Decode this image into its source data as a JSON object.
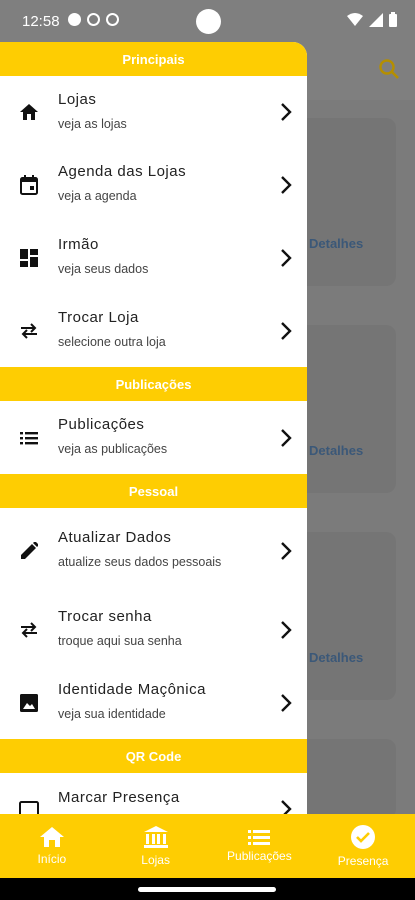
{
  "status_bar": {
    "time": "12:58"
  },
  "drawer": {
    "sections": [
      {
        "title": "Principais",
        "items": [
          {
            "title": "Lojas",
            "subtitle": "veja as lojas",
            "icon": "home-icon"
          },
          {
            "title": "Agenda das Lojas",
            "subtitle": "veja a agenda",
            "icon": "calendar-icon"
          },
          {
            "title": "Irmão",
            "subtitle": "veja seus dados",
            "icon": "dashboard-icon"
          },
          {
            "title": "Trocar Loja",
            "subtitle": "selecione outra loja",
            "icon": "swap-icon"
          }
        ]
      },
      {
        "title": "Publicações",
        "items": [
          {
            "title": "Publicações",
            "subtitle": "veja as publicações",
            "icon": "list-icon"
          }
        ]
      },
      {
        "title": "Pessoal",
        "items": [
          {
            "title": "Atualizar Dados",
            "subtitle": "atualize seus dados pessoais",
            "icon": "pencil-icon"
          },
          {
            "title": "Trocar senha",
            "subtitle": "troque aqui sua senha",
            "icon": "swap-icon"
          },
          {
            "title": "Identidade Maçônica",
            "subtitle": "veja sua identidade",
            "icon": "image-icon"
          }
        ]
      },
      {
        "title": "QR Code",
        "items": [
          {
            "title": "Marcar Presença",
            "subtitle": "",
            "icon": "qr-scan-icon"
          }
        ]
      }
    ]
  },
  "background": {
    "detail_links": [
      "Detalhes",
      "Detalhes",
      "Detalhes"
    ]
  },
  "bottom_nav": {
    "items": [
      {
        "label": "Início",
        "icon": "home-icon"
      },
      {
        "label": "Lojas",
        "icon": "bank-icon"
      },
      {
        "label": "Publicações",
        "icon": "list-icon"
      },
      {
        "label": "Presença",
        "icon": "check-circle-icon"
      }
    ]
  },
  "colors": {
    "accent": "#fecd02",
    "scrim": "#7f7f7f",
    "link": "#3b5878"
  }
}
